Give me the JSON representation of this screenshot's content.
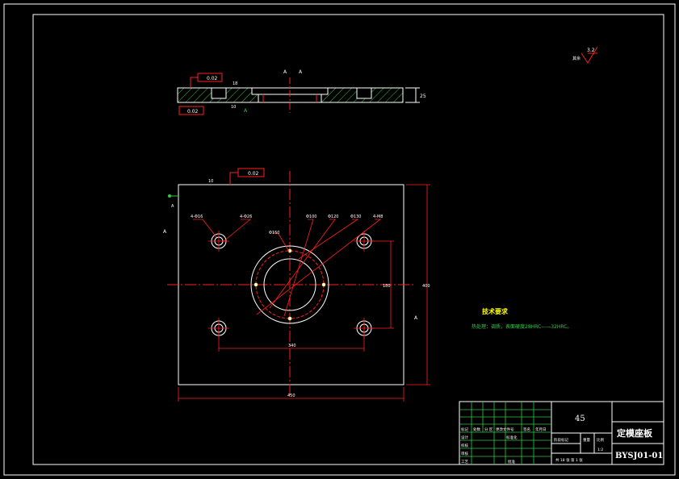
{
  "title_block": {
    "material": "45",
    "part_name": "定模座板",
    "drawing_number": "BYSJ01-01",
    "row_labels": [
      "标记",
      "处数",
      "分 区",
      "更改文件号",
      "签名",
      "年月日"
    ],
    "left_labels": [
      "设计",
      "校核",
      "审核",
      "工艺"
    ],
    "sign_labels": [
      "标准化",
      "批准"
    ],
    "stage_label": "阶段标记",
    "weight_label": "重量",
    "scale_label": "比例",
    "scale_value": "1:2",
    "sheets_text": "共 18 张  第 1 张"
  },
  "tech_requirements": {
    "heading": "技术要求",
    "line1": "热处理：调质，表面硬度28HRC——32HRC。"
  },
  "annotations": {
    "roughness_main": "3.2",
    "roughness_other": "其余",
    "flatness_top": "0.02",
    "perpendicular_side": "0.02",
    "parallel_plan": "0.02",
    "datum_a": "A",
    "dim_width": "450",
    "dim_height": "400",
    "dim_hole_pitch_x": "340",
    "dim_hole_pitch_y": "180",
    "dim_thickness": "25",
    "dim_ring": "Φ150",
    "dim_hole1": "4-Φ16",
    "dim_hole2": "4-Φ26",
    "dim_bore": "Φ100",
    "dim_pcd": "Φ120",
    "dim_pcd2": "Φ130",
    "dim_small_holes": "4-M8",
    "depth_note": "18",
    "edge_note": "10",
    "section_a": "A",
    "side_mark": "A"
  },
  "colors": {
    "border": "#ffffff",
    "outline": "#ffffff",
    "centerline": "#ff2020",
    "hatch": "#2ecc40",
    "dimension": "#ff2020",
    "text_green": "#2ecc40",
    "text_yellow": "#ffff00",
    "text_white": "#ffffff"
  }
}
